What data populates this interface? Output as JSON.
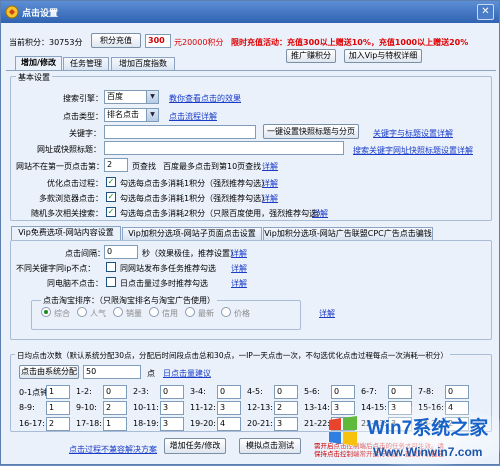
{
  "window": {
    "title": "点击设置"
  },
  "header": {
    "points_label": "当前积分：30753分",
    "recharge_button": "积分充值",
    "amount_value": "300",
    "amount_suffix": "元20000积分",
    "promo_text": "限时充值活动：充值300以上赠送10%，充值1000以上赠送20%",
    "promote_button": "推广赚积分",
    "vip_button": "加入Vip与特权详细"
  },
  "tabs": [
    "增加/修改",
    "任务管理",
    "增加百度指数"
  ],
  "basic": {
    "group_label": "基本设置",
    "engine_label": "搜索引擎：",
    "engine_value": "百度",
    "engine_link": "教你查看点击的效果",
    "click_type_label": "点击类型：",
    "click_type_value": "排名点击",
    "click_type_link": "点击流程详解",
    "keyword_label": "关键字：",
    "keyword_value": "",
    "fetch_button": "一键设置快照标题与分页",
    "keyword_link": "关键字与标题设置详解",
    "url_label": "网址或快照标题：",
    "url_value": "",
    "url_link": "搜索关键字网址快照标题设置详解",
    "not_first_label": "网站不在第一页点击第：",
    "not_first_value": "2",
    "not_first_suffix": "页查找",
    "not_first_hint": "百度最多点击到第10页查找",
    "not_first_link": "详解",
    "opt_click_label": "优化点击过程：",
    "opt_click_text": "勾选每点击多消耗1积分（强烈推荐勾选）",
    "opt_click_link": "详解",
    "multi_browser_label": "多款浏览器点击：",
    "multi_browser_text": "勾选每点击多消耗1积分（强烈推荐勾选）",
    "multi_browser_link": "详解",
    "random_kw_label": "随机多次相关搜索：",
    "random_kw_text": "勾选每点击多消耗2积分（只限百度使用，强烈推荐勾选）",
    "random_kw_link": "详解"
  },
  "subtabs": [
    "Vip免费选项-网站内容设置",
    "Vip加积分选项-网站子页面点击设置",
    "Vip加积分选项-网站广告联盟CPC广告点击骗钱"
  ],
  "vip": {
    "interval_label": "点击间隔：",
    "interval_value": "0",
    "interval_hint": "秒（效果极佳，推荐设置）",
    "interval_link": "详解",
    "ip_label": "不同关键字同ip不点：",
    "ip_text": "同网站发布多任务推荐勾选",
    "ip_link": "详解",
    "same_site_label": "同电脑不点击：",
    "same_site_text": "日点击量过多时推荐勾选",
    "same_site_link": "详解",
    "taobao_group": "点击淘宝排序：（只限淘宝排名与淘宝广告使用）",
    "sort_options": [
      "综合",
      "人气",
      "销量",
      "信用",
      "最新",
      "价格"
    ],
    "sort_link": "详解"
  },
  "daily": {
    "group_label": "日均点击次数（默认系统分配30点，分配后时间段点击总和30点，一IP一天点击一次，不勾选优化点击过程每点一次消耗一积分）",
    "auto_button": "点击由系统分配",
    "auto_value": "50",
    "auto_suffix": "点",
    "auto_link": "日点击量建议",
    "slots": [
      {
        "label": "0-1点钟:",
        "value": "1"
      },
      {
        "label": "1-2:",
        "value": "0"
      },
      {
        "label": "2-3:",
        "value": "0"
      },
      {
        "label": "3-4:",
        "value": "0"
      },
      {
        "label": "4-5:",
        "value": "0"
      },
      {
        "label": "5-6:",
        "value": "0"
      },
      {
        "label": "6-7:",
        "value": "0"
      },
      {
        "label": "7-8:",
        "value": "0"
      },
      {
        "label": "8-9:",
        "value": "1"
      },
      {
        "label": "9-10:",
        "value": "2"
      },
      {
        "label": "10-11:",
        "value": "3"
      },
      {
        "label": "11-12:",
        "value": "3"
      },
      {
        "label": "12-13:",
        "value": "2"
      },
      {
        "label": "13-14:",
        "value": "3"
      },
      {
        "label": "14-15:",
        "value": "3"
      },
      {
        "label": "15-16:",
        "value": "4"
      },
      {
        "label": "16-17:",
        "value": "2"
      },
      {
        "label": "17-18:",
        "value": "1"
      },
      {
        "label": "18-19:",
        "value": "3"
      },
      {
        "label": "19-20:",
        "value": "4"
      },
      {
        "label": "20-21:",
        "value": "3"
      },
      {
        "label": "21-22:",
        "value": "4"
      },
      {
        "label": "22-23:",
        "value": "3"
      },
      {
        "label": "23-24:",
        "value": "2"
      }
    ]
  },
  "footer": {
    "help_link": "点击过程不兼容解决方案",
    "add_button": "增加任务/修改",
    "sim_button": "模拟点击测试",
    "notice": "需开启点击控制端后点击的任务才可生效。请保持点击控制端常开运行状态，建议开机自启"
  },
  "watermark": {
    "brand": "Win7系统之家",
    "url": "Www.Winwin7.com"
  }
}
